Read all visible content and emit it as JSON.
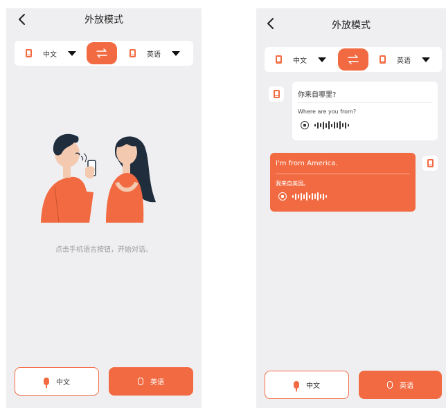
{
  "left": {
    "title": "外放模式",
    "source_lang": "中文",
    "target_lang": "英语",
    "hint": "点击手机语言按钮，开始对话。",
    "btn_source": "中文",
    "btn_target": "英语"
  },
  "right": {
    "title": "外放模式",
    "source_lang": "中文",
    "target_lang": "英语",
    "msg1_original": "你来自哪里?",
    "msg1_translation": "Where are you from?",
    "msg2_original": "I'm from America.",
    "msg2_translation": "我来自美国。",
    "btn_source": "中文",
    "btn_target": "英语"
  },
  "icons": {
    "back": "chevron-left-icon",
    "swap": "swap-arrows-icon",
    "phone": "phone-icon",
    "caret": "caret-down-icon",
    "mic": "microphone-icon",
    "speaker": "speaker-icon"
  },
  "colors": {
    "accent": "#f26a41",
    "background": "#efeff1",
    "card": "#ffffff",
    "hint_text": "#9a9a9a"
  }
}
